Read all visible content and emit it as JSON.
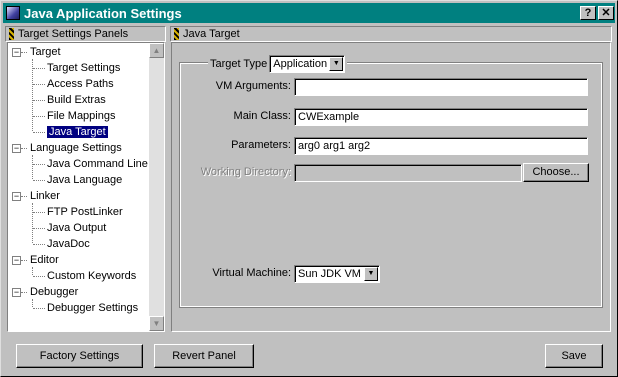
{
  "window": {
    "title": "Java Application Settings",
    "help_label": "?",
    "close_label": "✕"
  },
  "left_panel": {
    "header": "Target Settings Panels",
    "tree": [
      {
        "label": "Target",
        "level": 0,
        "expanded": true
      },
      {
        "label": "Target Settings",
        "level": 1
      },
      {
        "label": "Access Paths",
        "level": 1
      },
      {
        "label": "Build Extras",
        "level": 1
      },
      {
        "label": "File Mappings",
        "level": 1
      },
      {
        "label": "Java Target",
        "level": 1,
        "selected": true
      },
      {
        "label": "Language Settings",
        "level": 0,
        "expanded": true
      },
      {
        "label": "Java Command Line",
        "level": 1
      },
      {
        "label": "Java Language",
        "level": 1
      },
      {
        "label": "Linker",
        "level": 0,
        "expanded": true
      },
      {
        "label": "FTP PostLinker",
        "level": 1
      },
      {
        "label": "Java Output",
        "level": 1
      },
      {
        "label": "JavaDoc",
        "level": 1
      },
      {
        "label": "Editor",
        "level": 0,
        "expanded": true
      },
      {
        "label": "Custom Keywords",
        "level": 1
      },
      {
        "label": "Debugger",
        "level": 0,
        "expanded": true
      },
      {
        "label": "Debugger Settings",
        "level": 1
      }
    ]
  },
  "right_panel": {
    "header": "Java Target",
    "target_type_label": "Target Type",
    "target_type_value": "Application",
    "vm_arguments_label": "VM Arguments:",
    "vm_arguments_value": "",
    "main_class_label": "Main Class:",
    "main_class_value": "CWExample",
    "parameters_label": "Parameters:",
    "parameters_value": "arg0 arg1 arg2",
    "working_dir_label": "Working Directory:",
    "working_dir_value": "",
    "choose_label": "Choose...",
    "virtual_machine_label": "Virtual Machine:",
    "virtual_machine_value": "Sun JDK VM"
  },
  "footer": {
    "factory_settings_label": "Factory Settings",
    "revert_panel_label": "Revert Panel",
    "save_label": "Save"
  },
  "colors": {
    "titlebar": "#008080",
    "selection": "#000080",
    "face": "#c0c0c0"
  }
}
